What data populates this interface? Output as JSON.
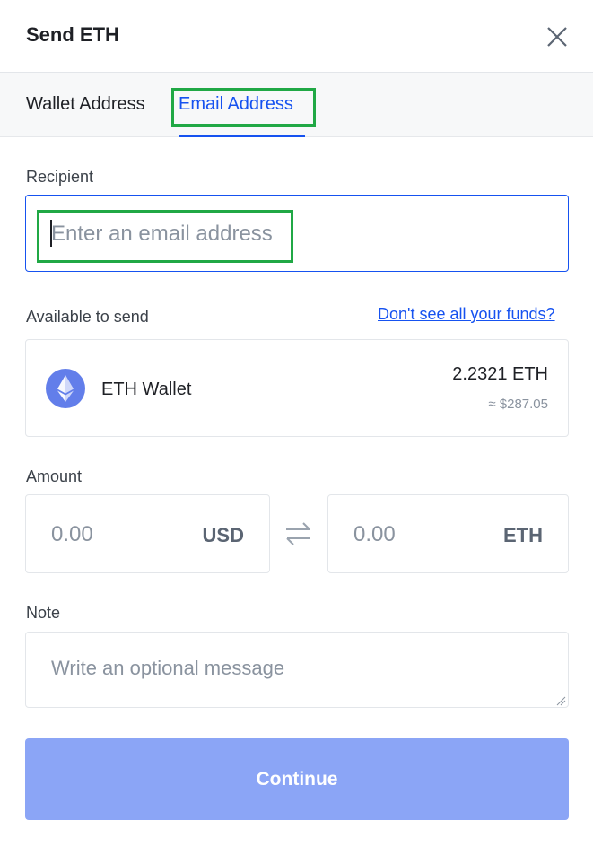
{
  "header": {
    "title": "Send ETH",
    "close_icon": "close-icon"
  },
  "tabs": [
    {
      "label": "Wallet Address",
      "active": false
    },
    {
      "label": "Email Address",
      "active": true
    }
  ],
  "recipient": {
    "label": "Recipient",
    "placeholder": "Enter an email address",
    "value": ""
  },
  "available": {
    "label": "Available to send",
    "link": "Don't see all your funds?",
    "wallet": {
      "name": "ETH Wallet",
      "balance": "2.2321 ETH",
      "fiat": "≈ $287.05",
      "icon": "ethereum-icon"
    }
  },
  "amount": {
    "label": "Amount",
    "fiat": {
      "placeholder": "0.00",
      "currency": "USD"
    },
    "crypto": {
      "placeholder": "0.00",
      "currency": "ETH"
    },
    "swap_icon": "swap-arrows-icon"
  },
  "note": {
    "label": "Note",
    "placeholder": "Write an optional message"
  },
  "continue": {
    "label": "Continue"
  },
  "colors": {
    "accent": "#1652f0",
    "button_disabled": "#8ba5f6",
    "highlight": "#20a845"
  }
}
